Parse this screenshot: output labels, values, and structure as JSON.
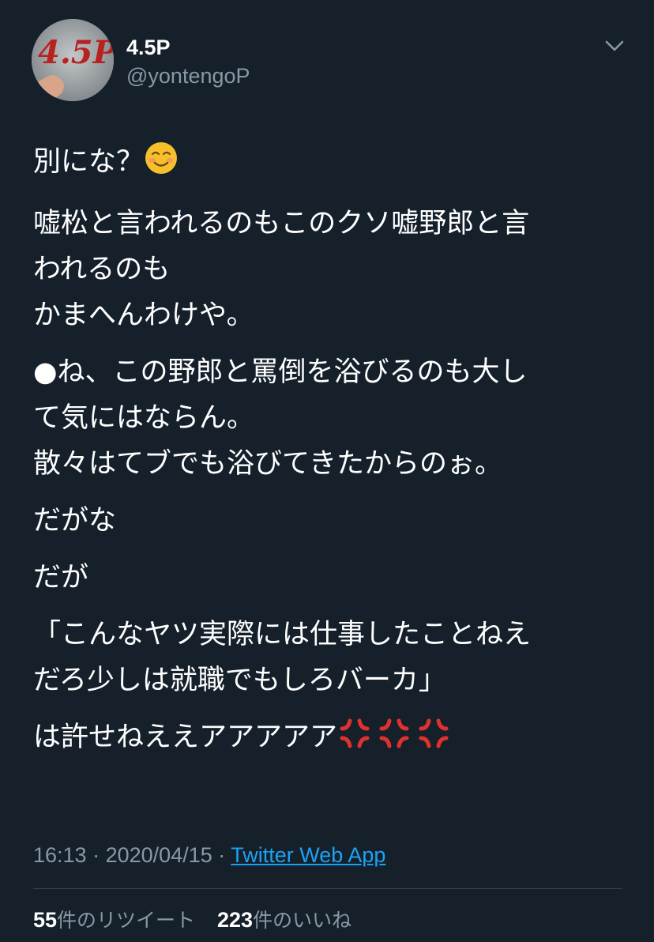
{
  "author": {
    "display_name": "4.5P",
    "handle": "@yontengoP",
    "avatar_text": "4.5P"
  },
  "header": {
    "menu_icon": "chevron-down-icon"
  },
  "tweet": {
    "p1": {
      "text": "別にな？",
      "emoji": "smiling-face-icon"
    },
    "p2": {
      "line1": "嘘松と言われるのもこのクソ嘘野郎と言",
      "line2": "われるのも",
      "line3": "かまへんわけや。"
    },
    "p3": {
      "line1": "●ね、この野郎と罵倒を浴びるのも大し",
      "line2": "て気にはならん。",
      "line3": "散々はてブでも浴びてきたからのぉ。"
    },
    "p4": "だがな",
    "p5": "だが",
    "p6": {
      "line1": "「こんなヤツ実際には仕事したことねえ",
      "line2": "だろ少しは就職でもしろバーカ」"
    },
    "p7": {
      "text": "は許せねええアアアアア",
      "emoji": "anger-symbol-icon",
      "emoji_count": 3
    }
  },
  "meta": {
    "time": "16:13",
    "separator": "·",
    "date": "2020/04/15",
    "source": "Twitter Web App"
  },
  "stats": {
    "retweets_count": "55",
    "retweets_label": "件のリツイート",
    "likes_count": "223",
    "likes_label": "件のいいね"
  },
  "colors": {
    "background": "#15202b",
    "text": "#ffffff",
    "secondary": "#8899a6",
    "link": "#1da1f2",
    "divider": "#38444d",
    "anger": "#e0322d",
    "smile": "#f7c02b"
  }
}
